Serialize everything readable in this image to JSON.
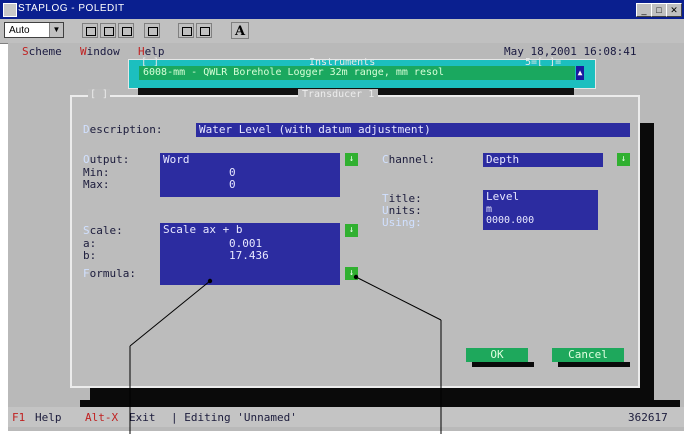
{
  "window": {
    "title": "STAPLOG - POLEDIT"
  },
  "toolbar": {
    "font_select": "Auto",
    "font_button": "A"
  },
  "menu": {
    "items": [
      {
        "hotkey": "S",
        "rest": "cheme"
      },
      {
        "hotkey": "W",
        "rest": "indow"
      },
      {
        "hotkey": "H",
        "rest": "elp"
      }
    ],
    "clock": "May 18,2001 16:08:41"
  },
  "instruments": {
    "frame_title": "Instruments",
    "frame_left": "[ ]",
    "frame_right": "5=[ ]=",
    "item": "6008-mm - QWLR Borehole Logger 32m range, mm resol"
  },
  "dialog": {
    "title": "Transducer 1",
    "close": "[ ]",
    "description": {
      "hotkey": "D",
      "rest": "escription:",
      "value": "Water Level (with datum adjustment)"
    },
    "output": {
      "hotkey": "O",
      "rest": "utput:",
      "value": "Word"
    },
    "min": {
      "label": "Min:",
      "value": "0"
    },
    "max": {
      "label": "Max:",
      "value": "0"
    },
    "channel": {
      "hotkey": "C",
      "rest": "hannel:",
      "value": "Depth"
    },
    "title_field": {
      "hotkey": "T",
      "rest": "itle:",
      "value": "Level"
    },
    "units": {
      "hotkey": "U",
      "rest": "nits:",
      "value": "m"
    },
    "using": {
      "label": "Using:",
      "value": "0000.000"
    },
    "scale": {
      "hotkey": "S",
      "rest": "cale:",
      "value": "Scale ax + b"
    },
    "a": {
      "label": "a:",
      "value": "0.001"
    },
    "b": {
      "label": "b:",
      "value": "17.436"
    },
    "formula": {
      "hotkey": "F",
      "rest": "ormula:"
    },
    "ok": "OK",
    "cancel": "Cancel"
  },
  "statusbar": {
    "f1_key": "F1",
    "f1_label": "Help",
    "altx_key": "Alt-X",
    "altx_label": "Exit",
    "editing": "| Editing 'Unnamed'",
    "memory": "362617"
  },
  "colors": {
    "title_bar": "#0a1f8f",
    "dos_bg": "#b9b9b9",
    "field_bg": "#2c2ca0",
    "button_green": "#1ea85c",
    "frame_cyan": "#1cbfbf"
  }
}
